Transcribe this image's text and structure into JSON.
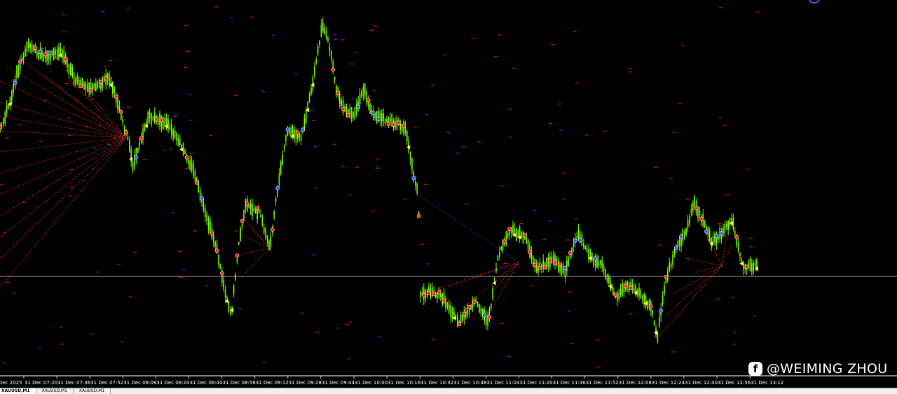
{
  "chart_data": {
    "type": "candlestick",
    "colors": {
      "background": "#000000",
      "candle": "#7CFC00",
      "crosshair": "#a0a0a0",
      "signal_up_marker": "#ff2020",
      "signal_down_marker": "#2a5bff",
      "arrow_marker": "#ffff66",
      "fan_lines": "#e02020",
      "dashes_red": "#d01010",
      "dashes_blue": "#1a3cc0"
    },
    "x_tick_labels": [
      "Dec 2025",
      "31 Dec 07:20",
      "31 Dec 07:36",
      "31 Dec 07:52",
      "31 Dec 08:08",
      "31 Dec 08:24",
      "31 Dec 08:40",
      "31 Dec 08:56",
      "31 Dec 09:12",
      "31 Dec 09:28",
      "31 Dec 09:44",
      "31 Dec 10:00",
      "31 Dec 10:16",
      "31 Dec 10:32",
      "31 Dec 10:48",
      "31 Dec 11:04",
      "31 Dec 11:20",
      "31 Dec 11:36",
      "31 Dec 11:52",
      "31 Dec 12:08",
      "31 Dec 12:24",
      "31 Dec 12:40",
      "31 Dec 12:56",
      "31 Dec 13:12"
    ],
    "price_path_relative": [
      [
        0,
        0.34
      ],
      [
        14,
        0.26
      ],
      [
        24,
        0.18
      ],
      [
        40,
        0.1
      ],
      [
        60,
        0.13
      ],
      [
        88,
        0.12
      ],
      [
        108,
        0.2
      ],
      [
        132,
        0.22
      ],
      [
        156,
        0.19
      ],
      [
        168,
        0.26
      ],
      [
        182,
        0.36
      ],
      [
        190,
        0.44
      ],
      [
        200,
        0.37
      ],
      [
        212,
        0.3
      ],
      [
        238,
        0.32
      ],
      [
        258,
        0.38
      ],
      [
        278,
        0.46
      ],
      [
        292,
        0.57
      ],
      [
        308,
        0.66
      ],
      [
        320,
        0.78
      ],
      [
        330,
        0.86
      ],
      [
        340,
        0.67
      ],
      [
        350,
        0.55
      ],
      [
        370,
        0.57
      ],
      [
        385,
        0.67
      ],
      [
        395,
        0.52
      ],
      [
        410,
        0.34
      ],
      [
        430,
        0.36
      ],
      [
        445,
        0.22
      ],
      [
        460,
        0.04
      ],
      [
        470,
        0.1
      ],
      [
        480,
        0.22
      ],
      [
        490,
        0.28
      ],
      [
        505,
        0.3
      ],
      [
        520,
        0.22
      ],
      [
        530,
        0.29
      ],
      [
        550,
        0.31
      ],
      [
        565,
        0.32
      ],
      [
        580,
        0.34
      ],
      [
        590,
        0.46
      ],
      [
        597,
        0.52
      ],
      [
        600,
        0.8
      ],
      [
        615,
        0.79
      ],
      [
        632,
        0.81
      ],
      [
        655,
        0.88
      ],
      [
        680,
        0.82
      ],
      [
        697,
        0.88
      ],
      [
        710,
        0.7
      ],
      [
        728,
        0.62
      ],
      [
        750,
        0.64
      ],
      [
        765,
        0.73
      ],
      [
        790,
        0.7
      ],
      [
        805,
        0.74
      ],
      [
        825,
        0.63
      ],
      [
        845,
        0.7
      ],
      [
        860,
        0.72
      ],
      [
        880,
        0.81
      ],
      [
        895,
        0.77
      ],
      [
        915,
        0.8
      ],
      [
        930,
        0.84
      ],
      [
        938,
        0.92
      ],
      [
        950,
        0.76
      ],
      [
        965,
        0.67
      ],
      [
        980,
        0.62
      ],
      [
        990,
        0.54
      ],
      [
        1000,
        0.58
      ],
      [
        1015,
        0.65
      ],
      [
        1030,
        0.63
      ],
      [
        1045,
        0.59
      ],
      [
        1060,
        0.72
      ],
      [
        1080,
        0.72
      ]
    ]
  },
  "watermark": {
    "icon": "facebook-icon",
    "icon_glyph": "f",
    "text": "@WEIMING ZHOU"
  },
  "tabs": [
    "XAUUSD,M1",
    "XAUUSD,M1",
    "XAUUSD,M1"
  ]
}
